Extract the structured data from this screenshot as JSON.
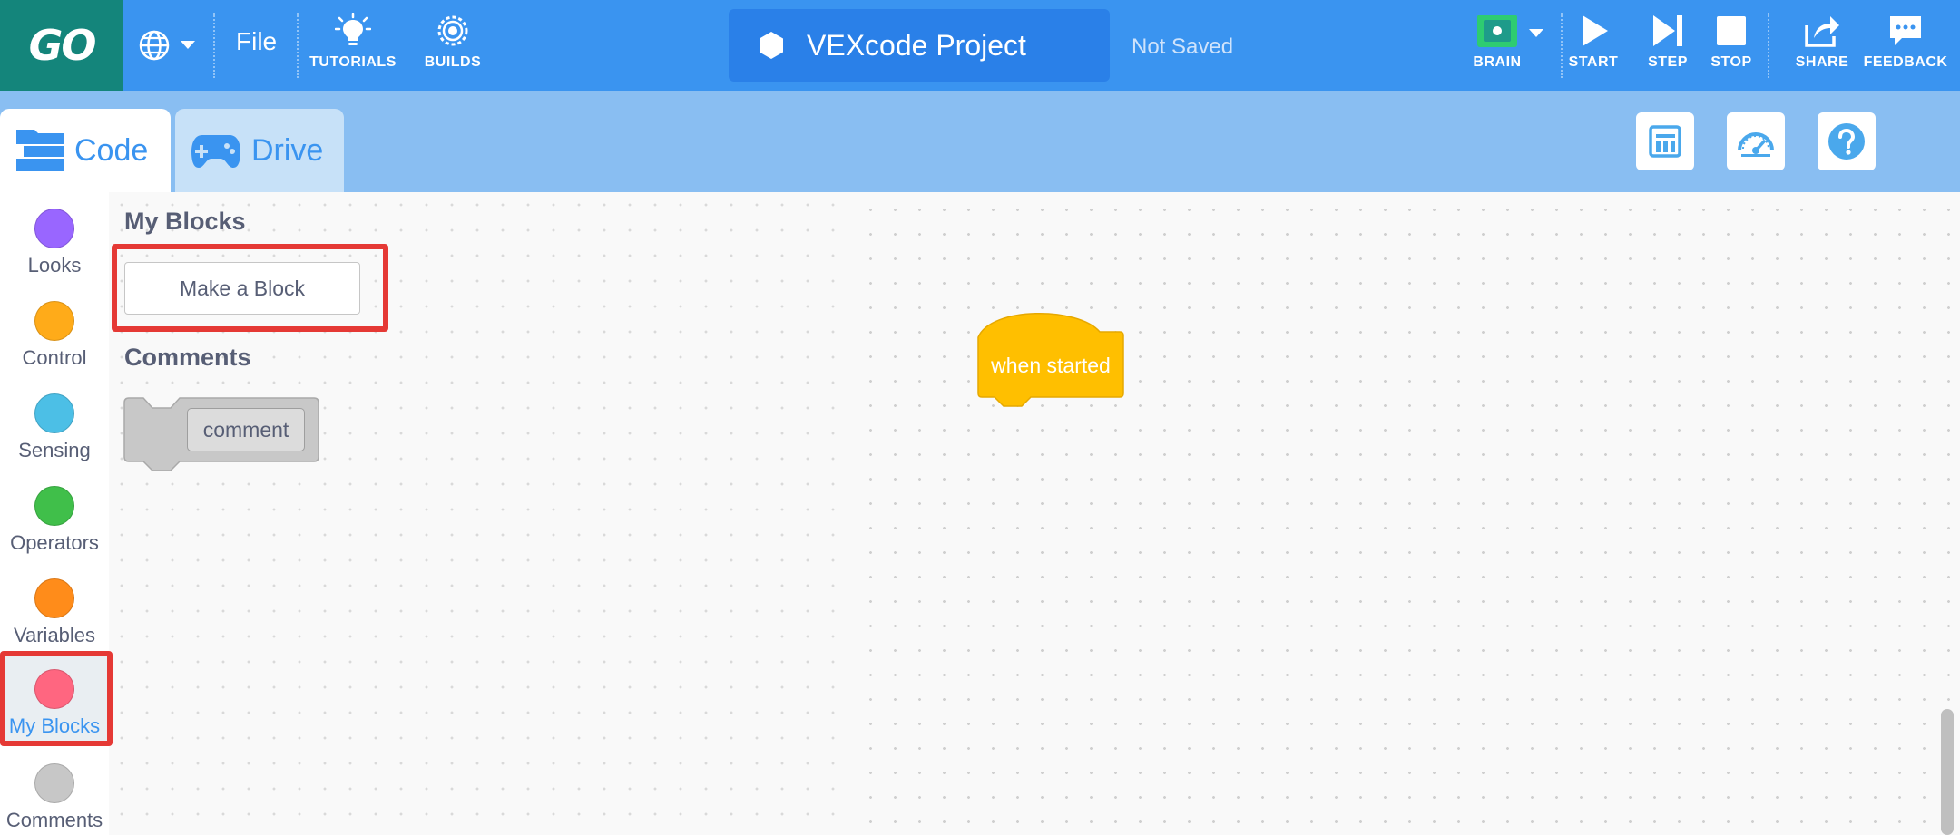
{
  "app": {
    "logo": "GO",
    "file_menu": "File",
    "tools": {
      "tutorials": "TUTORIALS",
      "builds": "BUILDS"
    },
    "project_name": "VEXcode Project",
    "save_status": "Not Saved",
    "controls": {
      "brain": "BRAIN",
      "start": "START",
      "step": "STEP",
      "stop": "STOP",
      "share": "SHARE",
      "feedback": "FEEDBACK"
    }
  },
  "tabs": [
    {
      "label": "Code",
      "icon": "code-blocks-icon",
      "active": true
    },
    {
      "label": "Drive",
      "icon": "gamepad-icon",
      "active": false
    }
  ],
  "utility_icons": [
    "devices-icon",
    "dashboard-gauge-icon",
    "help-icon"
  ],
  "categories": [
    {
      "label": "Looks",
      "color": "#9966ff"
    },
    {
      "label": "Control",
      "color": "#ffab19"
    },
    {
      "label": "Sensing",
      "color": "#4cbfe6"
    },
    {
      "label": "Operators",
      "color": "#40bf4a"
    },
    {
      "label": "Variables",
      "color": "#ff8c1a"
    },
    {
      "label": "My Blocks",
      "color": "#ff6680",
      "selected": true
    },
    {
      "label": "Comments",
      "color": "#c7c7c7"
    }
  ],
  "flyout": {
    "my_blocks_heading": "My Blocks",
    "make_block_button": "Make a Block",
    "comments_heading": "Comments",
    "comment_block_text": "comment"
  },
  "workspace": {
    "hat_block_text": "when started"
  },
  "colors": {
    "menubar": "#3a94f0",
    "logo_bg": "#14857b",
    "tabs_row": "#89bef2",
    "hat_block": "#ffbf00",
    "highlight": "#e53935"
  }
}
